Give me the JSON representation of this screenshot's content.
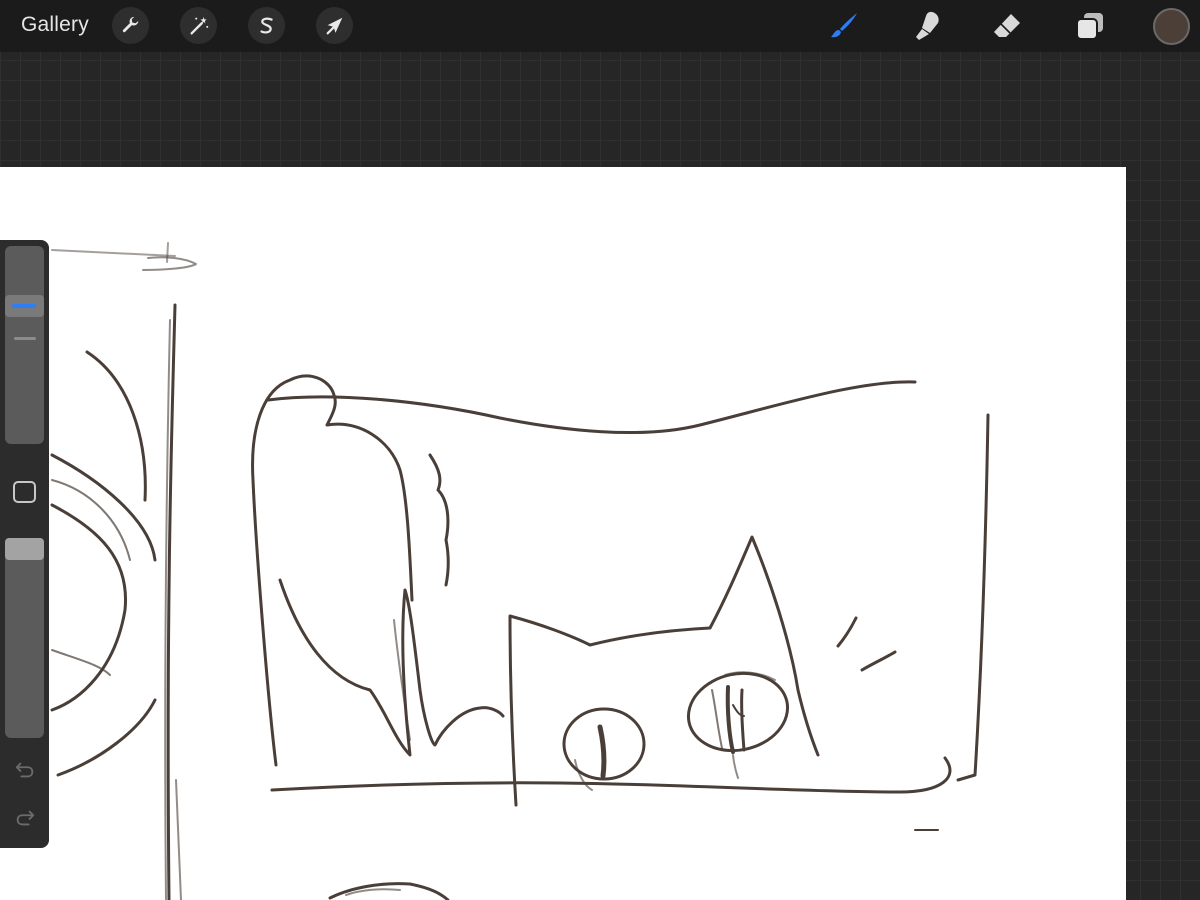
{
  "app": {
    "gallery_label": "Gallery"
  },
  "toolbar": {
    "left_tools": [
      {
        "name": "actions",
        "icon": "wrench-icon"
      },
      {
        "name": "adjustments",
        "icon": "magic-wand-icon"
      },
      {
        "name": "selection",
        "icon": "selection-s-icon"
      },
      {
        "name": "transform",
        "icon": "arrow-cursor-icon"
      }
    ],
    "right_tools": [
      {
        "name": "brush",
        "icon": "brush-icon",
        "active": true
      },
      {
        "name": "smudge",
        "icon": "smudge-finger-icon",
        "active": false
      },
      {
        "name": "eraser",
        "icon": "eraser-icon",
        "active": false
      },
      {
        "name": "layers",
        "icon": "layers-icon",
        "active": false
      }
    ],
    "current_color": "#4b3f38"
  },
  "sidebar": {
    "brush_size_level": 0.72,
    "opacity_level": 1.0,
    "undo_icon": "undo-icon",
    "redo_icon": "redo-icon"
  },
  "colors": {
    "accent": "#2d7df6",
    "stroke": "#4a3f38"
  }
}
